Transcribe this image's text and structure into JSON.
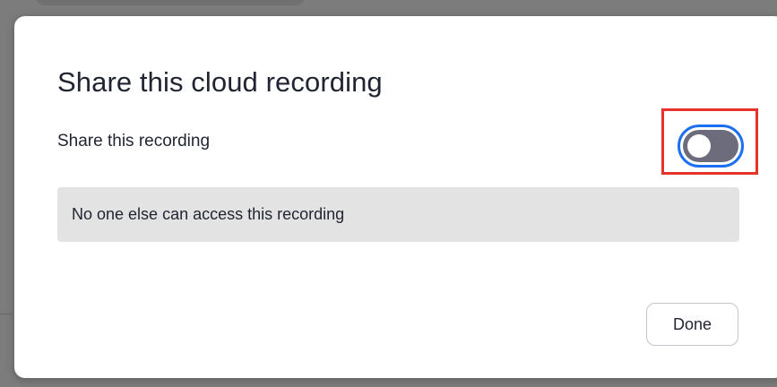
{
  "dialog": {
    "title": "Share this cloud recording",
    "share_label": "Share this recording",
    "share_toggle": {
      "checked": false,
      "highlighted": true
    },
    "access_message": "No one else can access this recording",
    "done_label": "Done"
  },
  "colors": {
    "toggle_track": "#6c6c7c",
    "toggle_focus_ring": "#1d6ff2",
    "highlight_box": "#e5322a",
    "access_box_bg": "#e3e3e3",
    "backdrop": "#7c7c7c"
  }
}
